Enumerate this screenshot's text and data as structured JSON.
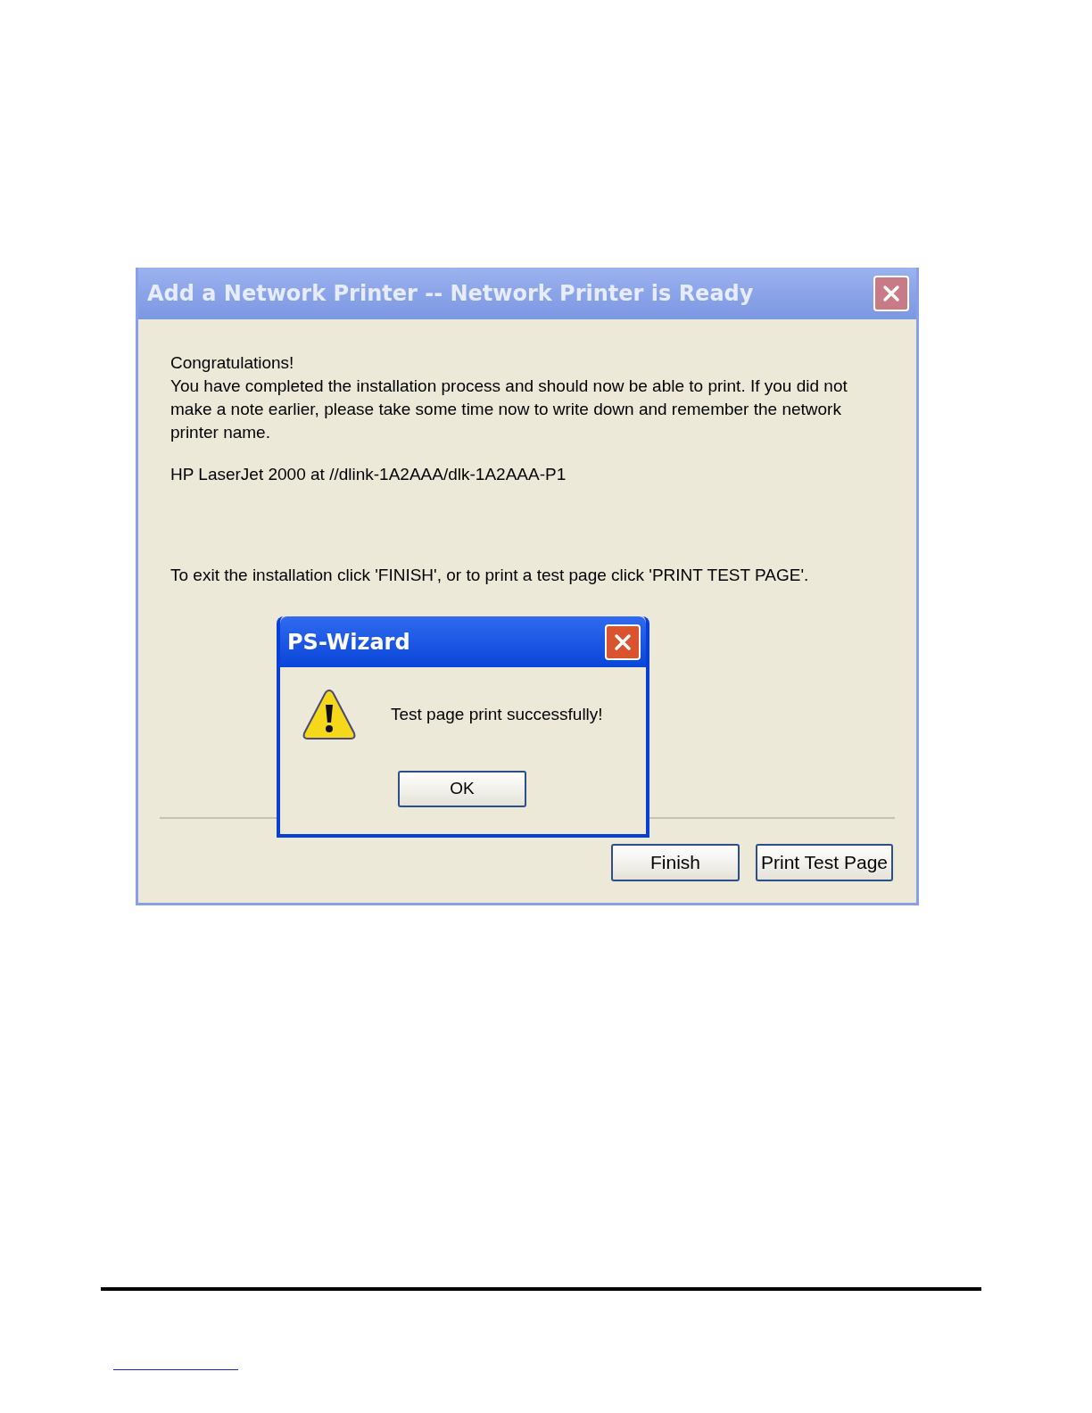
{
  "window": {
    "title": "Add a Network Printer -- Network Printer is Ready"
  },
  "message": {
    "heading": "Congratulations!",
    "body": "You have completed the installation process and should now be able to print. If you did not make a note earlier, please take some time now to write down and remember the network printer name.",
    "printer_name": "HP LaserJet 2000 at //dlink-1A2AAA/dlk-1A2AAA-P1",
    "instruction": "To exit the installation click 'FINISH', or to print a test page click 'PRINT TEST PAGE'."
  },
  "buttons": [
    "Finish",
    "Print Test Page"
  ],
  "popup": {
    "title": "PS-Wizard",
    "message": "Test page print successfully!",
    "button": "OK"
  }
}
